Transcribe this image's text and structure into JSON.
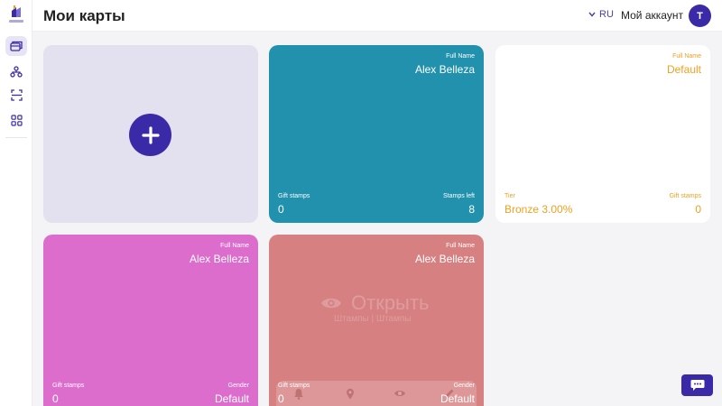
{
  "header": {
    "title": "Мои карты",
    "language": "RU",
    "account_label": "Мой аккаунт",
    "avatar_initial": "T"
  },
  "sidebar": {
    "items": [
      {
        "icon": "cards-icon",
        "active": true
      },
      {
        "icon": "network-icon",
        "active": false
      },
      {
        "icon": "scan-icon",
        "active": false
      },
      {
        "icon": "grid-icon",
        "active": false
      }
    ]
  },
  "cards": [
    {
      "full_name_label": "Full Name",
      "full_name": "Alex Belleza",
      "left_label": "Gift stamps",
      "left_value": "0",
      "right_label": "Stamps left",
      "right_value": "8",
      "color": "#2191ae"
    },
    {
      "full_name_label": "Full Name",
      "full_name": "Default",
      "left_label": "Tier",
      "left_value": "Bronze 3.00%",
      "right_label": "Gift stamps",
      "right_value": "0",
      "color": "#ffffff",
      "text_color": "#f0a020"
    },
    {
      "full_name_label": "Full Name",
      "full_name": "Alex Belleza",
      "left_label": "Gift stamps",
      "left_value": "0",
      "right_label": "Gender",
      "right_value": "Default",
      "color": "#dd6dcd"
    },
    {
      "full_name_label": "Full Name",
      "full_name": "Alex Belleza",
      "left_label": "Gift stamps",
      "left_value": "0",
      "right_label": "Gender",
      "right_value": "Default",
      "color": "#d78082",
      "hover_open": "Открыть",
      "hover_sub": "Штампы | Штампы"
    }
  ],
  "accent": "#3b2aa8"
}
